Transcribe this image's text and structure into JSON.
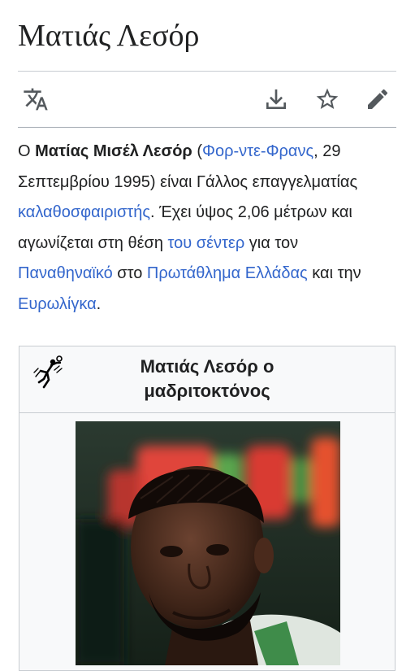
{
  "page": {
    "title": "Ματιάς Λεσόρ"
  },
  "toolbar": {
    "language_icon": "translate-icon",
    "download_icon": "download-icon",
    "watch_icon": "star-icon",
    "edit_icon": "pencil-icon"
  },
  "lead": {
    "prefix": "Ο ",
    "name_bold": "Ματίας Μισέλ Λεσόρ",
    "open_paren": " (",
    "birthplace_link": "Φορ-ντε-Φρανς",
    "after_birthplace": ", 29 Σεπτεμβρίου 1995) είναι Γάλλος επαγγελματίας ",
    "sport_link": "καλαθοσφαιριστής",
    "after_sport": ". Έχει ύψος 2,06 μέτρων και αγωνίζεται στη θέση ",
    "position_link": "του σέντερ",
    "after_position": " για τον ",
    "club_link": "Παναθηναϊκό",
    "after_club": " στο ",
    "league_link": "Πρωτάθλημα Ελλάδας",
    "after_league": " και την ",
    "euroleague_link": "Ευρωλίγκα",
    "end": "."
  },
  "infobox": {
    "icon": "basketball-player-icon",
    "title": "Ματιάς Λεσόρ ο μαδριτοκτόνος",
    "image": "player-photo"
  },
  "colors": {
    "link": "#3366cc",
    "text": "#202122",
    "icon": "#54595d",
    "border": "#c8ccd1",
    "infobox_bg": "#f8f9fa"
  }
}
